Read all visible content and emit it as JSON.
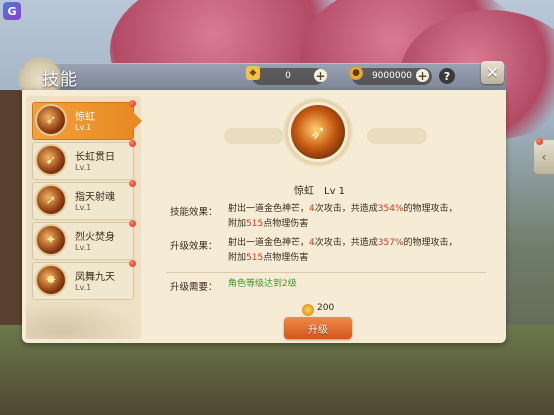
{
  "header": {
    "title": "技能",
    "gem_amount": "0",
    "coin_amount": "9000000",
    "help_symbol": "?",
    "close_symbol": "✕"
  },
  "skills": [
    {
      "name": "惊虹",
      "level": "Lv.1",
      "selected": true
    },
    {
      "name": "长虹贯日",
      "level": "Lv.1",
      "selected": false
    },
    {
      "name": "指天射魂",
      "level": "Lv.1",
      "selected": false
    },
    {
      "name": "烈火焚身",
      "level": "Lv.1",
      "selected": false
    },
    {
      "name": "凤舞九天",
      "level": "Lv.1",
      "selected": false
    }
  ],
  "detail": {
    "name": "惊虹",
    "level": "Lv 1",
    "effect_label": "技能效果：",
    "effect": {
      "t1": "射出一道金色神芒，",
      "hits": "4",
      "t2": "次攻击，共造成",
      "pct": "354%",
      "t3": "的物理攻击，",
      "t4": "附加",
      "flat": "515",
      "t5": "点物理伤害"
    },
    "upgrade_label": "升级效果：",
    "upgrade": {
      "t1": "射出一道金色神芒，",
      "hits": "4",
      "t2": "次攻击，共造成",
      "pct": "357%",
      "t3": "的物理攻击，",
      "t4": "附加",
      "flat": "515",
      "t5": "点物理伤害"
    },
    "require_label": "升级需要：",
    "require_text": "角色等级达到2级",
    "cost": "200",
    "upgrade_button": "升级"
  },
  "colors": {
    "accent_orange": "#e88a23",
    "highlight_red": "#d8361c",
    "requirement_green": "#3d9a2a",
    "panel_bg": "#f6ecd6"
  },
  "icons": {
    "gem": "gold-ingot-icon",
    "coin": "coin-icon",
    "skill": "fire-arrow-icon"
  }
}
